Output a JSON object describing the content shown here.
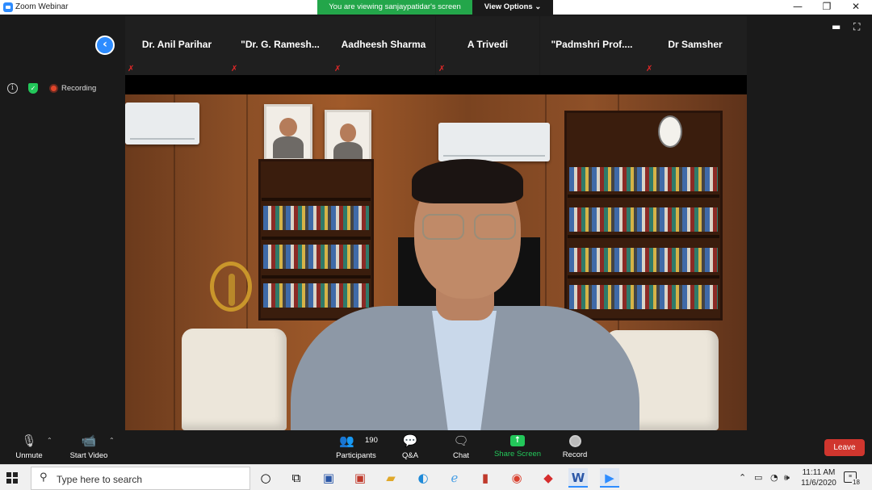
{
  "window": {
    "title": "Zoom Webinar",
    "minimize": "—",
    "restore": "❐",
    "close": "✕"
  },
  "banner": {
    "viewing_text": "You are viewing sanjaypatidar's screen",
    "view_options": "View Options ⌄"
  },
  "gallery": {
    "back_icon": "‹",
    "participants": [
      {
        "name": "Dr. Anil Parihar"
      },
      {
        "name": "\"Dr. G. Ramesh..."
      },
      {
        "name": "Aadheesh Sharma"
      },
      {
        "name": "A Trivedi"
      },
      {
        "name": "\"Padmshri Prof...."
      },
      {
        "name": "Dr Samsher"
      }
    ],
    "muted_icon": "mic-muted-icon"
  },
  "status": {
    "info_icon": "i",
    "shield_icon": "✓",
    "recording_label": "Recording"
  },
  "toolbar": {
    "unmute": "Unmute",
    "start_video": "Start Video",
    "participants": "Participants",
    "participants_count": "190",
    "qa": "Q&A",
    "chat": "Chat",
    "share_screen": "Share Screen",
    "record": "Record",
    "leave": "Leave",
    "caret": "⌃"
  },
  "taskbar": {
    "search_placeholder": "Type here to search",
    "time": "11:11 AM",
    "date": "11/6/2020",
    "notifications_count": "18",
    "tray_up": "⌃",
    "wifi": "◔",
    "volume": "🕪"
  },
  "colors": {
    "zoom_blue": "#2d8cff",
    "viewing_green": "#23a64a",
    "leave_red": "#d0362e",
    "muted_red": "#e02828"
  }
}
